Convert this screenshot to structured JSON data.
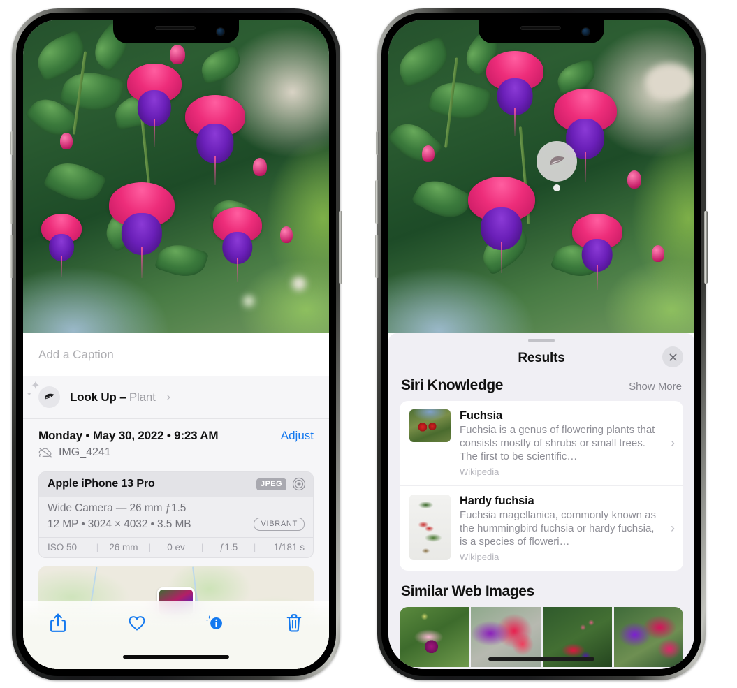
{
  "left_phone": {
    "caption_placeholder": "Add a Caption",
    "lookup": {
      "label": "Look Up – ",
      "subject": "Plant",
      "chevron": "›",
      "icon": "leaf-icon"
    },
    "meta": {
      "date": "Monday • May 30, 2022 • 9:23 AM",
      "adjust_label": "Adjust",
      "filename": "IMG_4241",
      "cloud_icon": "cloud-slash-icon"
    },
    "camera": {
      "model": "Apple iPhone 13 Pro",
      "format_tag": "JPEG",
      "aperture_icon": "aperture-icon",
      "lens_line": "Wide Camera — 26 mm ƒ1.5",
      "specs_line": "12 MP • 3024 × 4032 • 3.5 MB",
      "style_tag": "VIBRANT",
      "exif": [
        "ISO 50",
        "26 mm",
        "0 ev",
        "ƒ1.5",
        "1/181 s"
      ]
    },
    "toolbar": {
      "share_label": "share-button",
      "favorite_label": "favorite-button",
      "info_label": "info-button",
      "delete_label": "delete-button"
    }
  },
  "right_phone": {
    "badge_icon": "leaf-icon",
    "sheet": {
      "title": "Results",
      "close_label": "✕"
    },
    "siri_knowledge": {
      "title": "Siri Knowledge",
      "action": "Show More",
      "items": [
        {
          "title": "Fuchsia",
          "description": "Fuchsia is a genus of flowering plants that consists mostly of shrubs or small trees. The first to be scientific…",
          "source": "Wikipedia",
          "chevron": "›"
        },
        {
          "title": "Hardy fuchsia",
          "description": "Fuchsia magellanica, commonly known as the hummingbird fuchsia or hardy fuchsia, is a species of floweri…",
          "source": "Wikipedia",
          "chevron": "›"
        }
      ]
    },
    "similar_web_images": {
      "title": "Similar Web Images",
      "count": 4
    }
  },
  "colors": {
    "accent_blue": "#1479ef",
    "sheet_bg": "#f0eff4",
    "card_bg": "#ffffff",
    "muted_text": "#8e8e96"
  }
}
